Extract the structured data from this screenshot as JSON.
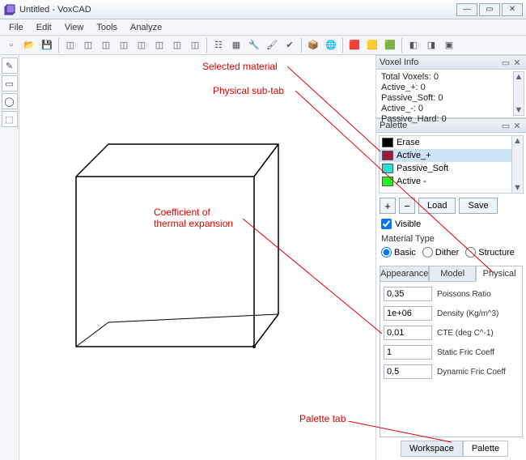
{
  "window": {
    "title": "Untitled - VoxCAD"
  },
  "menu": {
    "file": "File",
    "edit": "Edit",
    "view": "View",
    "tools": "Tools",
    "analyze": "Analyze"
  },
  "panels": {
    "voxel_info": {
      "title": "Voxel Info",
      "lines": {
        "total": "Total Voxels: 0",
        "active_p": "Active_+: 0",
        "passive_soft": "Passive_Soft: 0",
        "active_m": "Active_-: 0",
        "passive_hard": "Passive_Hard: 0"
      }
    },
    "palette": {
      "title": "Palette",
      "materials": [
        {
          "name": "Erase",
          "color": "#000000"
        },
        {
          "name": "Active_+",
          "color": "#9b1d3a"
        },
        {
          "name": "Passive_Soft",
          "color": "#28e0d6"
        },
        {
          "name": "Active -",
          "color": "#24f324"
        }
      ],
      "selected_index": 1,
      "buttons": {
        "add": "+",
        "remove": "−",
        "load": "Load",
        "save": "Save"
      },
      "visible_label": "Visible",
      "visible_checked": true,
      "material_type_label": "Material Type",
      "type_options": {
        "basic": "Basic",
        "dither": "Dither",
        "structure": "Structure"
      },
      "type_selected": "basic",
      "subtabs": {
        "appearance": "Appearance",
        "model": "Model",
        "physical": "Physical"
      },
      "subtab_active": "physical",
      "physical": {
        "poisson": {
          "value": "0.35",
          "label": "Poissons Ratio"
        },
        "density": {
          "value": "1e+06",
          "label": "Density (Kg/m^3)"
        },
        "cte": {
          "value": "0.01",
          "label": "CTE (deg C^-1)"
        },
        "static_fric": {
          "value": "1",
          "label": "Static Fric Coeff"
        },
        "dyn_fric": {
          "value": "0.5",
          "label": "Dynamic Fric Coeff"
        }
      }
    }
  },
  "bottom_tabs": {
    "workspace": "Workspace",
    "palette": "Palette",
    "active": "palette"
  },
  "annotations": {
    "selected_material": "Selected material",
    "physical_subtab": "Physical sub-tab",
    "cte": "Coefficient of\nthermal expansion",
    "palette_tab": "Palette tab"
  }
}
